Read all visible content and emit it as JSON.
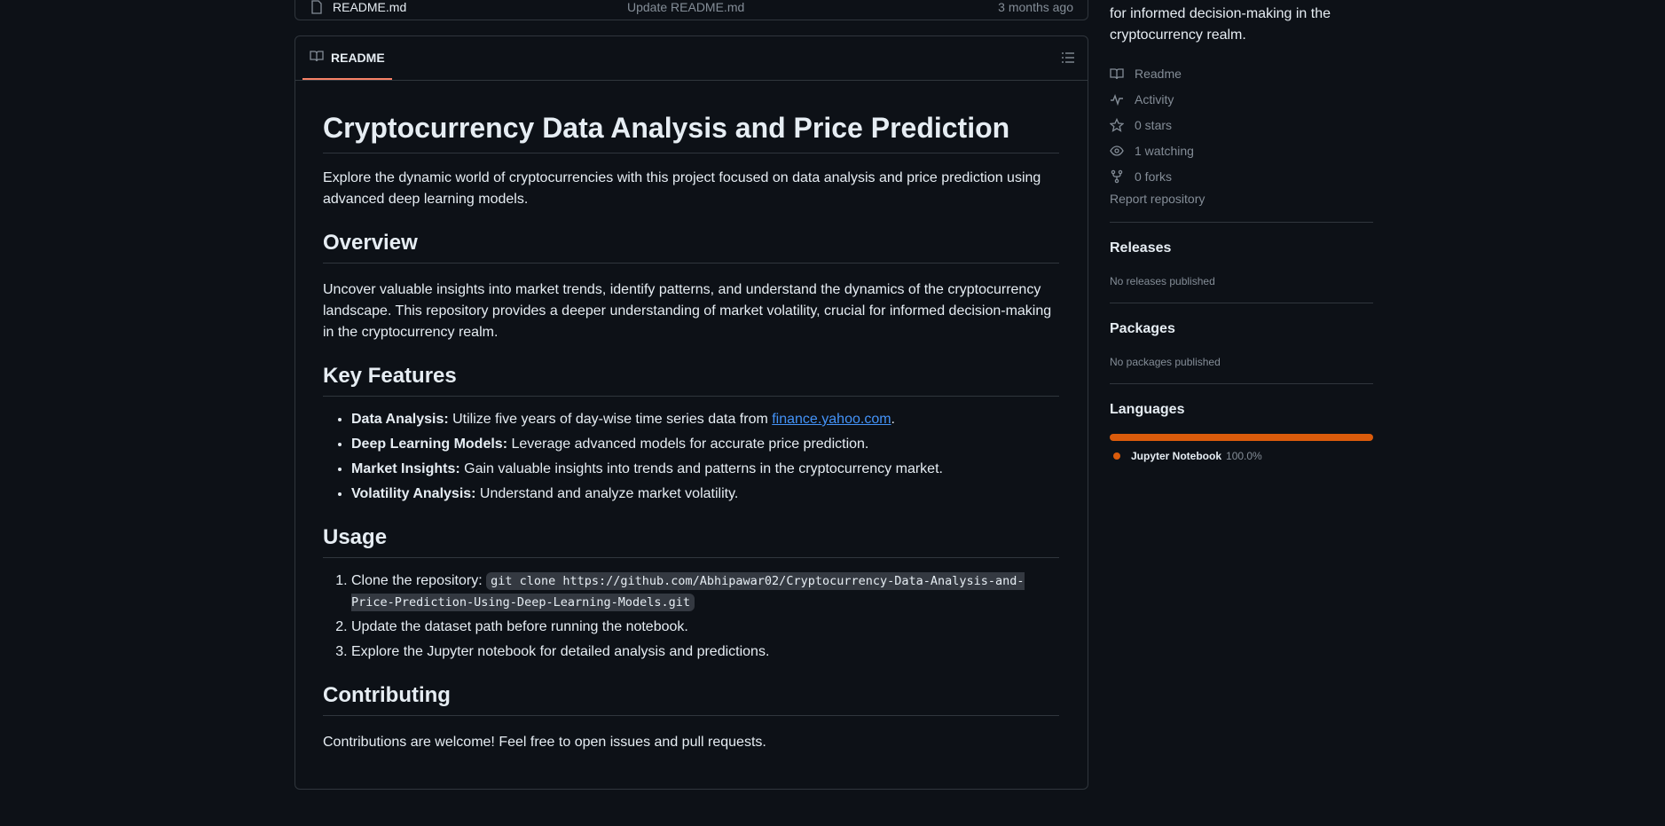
{
  "file_row": {
    "name": "README.md",
    "commit_message": "Update README.md",
    "date": "3 months ago"
  },
  "readme": {
    "tab_label": "README",
    "title": "Cryptocurrency Data Analysis and Price Prediction",
    "intro": "Explore the dynamic world of cryptocurrencies with this project focused on data analysis and price prediction using advanced deep learning models.",
    "overview_heading": "Overview",
    "overview_text": "Uncover valuable insights into market trends, identify patterns, and understand the dynamics of the cryptocurrency landscape. This repository provides a deeper understanding of market volatility, crucial for informed decision-making in the cryptocurrency realm.",
    "features_heading": "Key Features",
    "features": [
      {
        "label": "Data Analysis:",
        "text": " Utilize five years of day-wise time series data from ",
        "link": "finance.yahoo.com",
        "after": "."
      },
      {
        "label": "Deep Learning Models:",
        "text": " Leverage advanced models for accurate price prediction."
      },
      {
        "label": "Market Insights:",
        "text": " Gain valuable insights into trends and patterns in the cryptocurrency market."
      },
      {
        "label": "Volatility Analysis:",
        "text": " Understand and analyze market volatility."
      }
    ],
    "usage_heading": "Usage",
    "usage": [
      {
        "text": "Clone the repository: ",
        "code": "git clone https://github.com/Abhipawar02/Cryptocurrency-Data-Analysis-and-Price-Prediction-Using-Deep-Learning-Models.git"
      },
      {
        "text": "Update the dataset path before running the notebook."
      },
      {
        "text": "Explore the Jupyter notebook for detailed analysis and predictions."
      }
    ],
    "contributing_heading": "Contributing",
    "contributing_text": "Contributions are welcome! Feel free to open issues and pull requests."
  },
  "sidebar": {
    "about_text": "for informed decision-making in the cryptocurrency realm.",
    "meta": [
      {
        "icon": "book-icon",
        "label": "Readme"
      },
      {
        "icon": "pulse-icon",
        "label": "Activity"
      },
      {
        "icon": "star-icon",
        "label": "0 stars"
      },
      {
        "icon": "eye-icon",
        "label": "1 watching"
      },
      {
        "icon": "fork-icon",
        "label": "0 forks"
      }
    ],
    "report": "Report repository",
    "releases_heading": "Releases",
    "releases_text": "No releases published",
    "packages_heading": "Packages",
    "packages_text": "No packages published",
    "languages_heading": "Languages",
    "language": {
      "name": "Jupyter Notebook",
      "percent": "100.0%",
      "color": "#DA5B0B"
    }
  }
}
